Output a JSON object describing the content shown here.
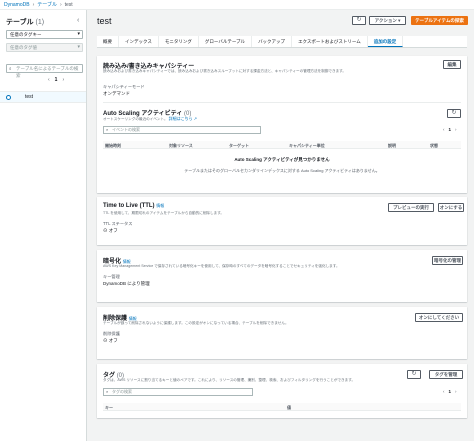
{
  "breadcrumb": {
    "root": "DynamoDB",
    "section": "テーブル",
    "current": "test"
  },
  "sidebar": {
    "title": "テーブル",
    "count": "(1)",
    "filter_select": "任意のタグキー",
    "value_select": "任意のタグ値",
    "search_placeholder": "テーブル名によるテーブルの検索",
    "page": "1",
    "tables": [
      {
        "name": "test"
      }
    ]
  },
  "header": {
    "title": "test",
    "actions_label": "アクション",
    "explore_label": "テーブルアイテムの探索"
  },
  "tabs": [
    {
      "label": "概要"
    },
    {
      "label": "インデックス"
    },
    {
      "label": "モニタリング"
    },
    {
      "label": "グローバルテーブル"
    },
    {
      "label": "バックアップ"
    },
    {
      "label": "エクスポートおよびストリーム"
    },
    {
      "label": "追加の設定"
    }
  ],
  "capacity": {
    "title": "読み込み/書き込みキャパシティー",
    "desc": "読み込みおよび書き込みキャパシティーでは、読み込みおよび書き込みスループットに対する課金方法と、キャパシティーの管理方法を制御できます。",
    "edit_label": "編集",
    "mode_label": "キャパシティーモード",
    "mode_value": "オンデマンド"
  },
  "autoscaling": {
    "title": "Auto Scaling アクティビティ",
    "count": "(0)",
    "desc": "オートスケーリングの最近のイベント。",
    "link": "詳細はこちら",
    "search_placeholder": "イベントの検索",
    "page": "1",
    "columns": [
      "開始時刻",
      "対象リソース",
      "ターゲット",
      "キャパシティー単位",
      "説明",
      "状態"
    ],
    "empty_title": "Auto Scaling アクティビティが見つかりません",
    "empty_desc": "テーブルまたはそのグローバルセカンダリインデックスに対する Auto Scaling アクティビティはありません。"
  },
  "ttl": {
    "title": "Time to Live (TTL)",
    "info": "情報",
    "desc": "TTL を使用して、期限切れのアイテムをテーブルから自動的に削除します。",
    "preview_label": "プレビューの実行",
    "enable_label": "オンにする",
    "status_label": "TTL ステータス",
    "status_value": "オフ"
  },
  "encryption": {
    "title": "暗号化",
    "info": "情報",
    "desc": "AWS Key Management Service で保存されている暗号化キーを使用して、保存時のすべてのデータを暗号化することでセキュリティを強化します。",
    "manage_label": "暗号化の管理",
    "key_label": "キー管理",
    "key_value": "DynamoDB により管理"
  },
  "deletion": {
    "title": "削除保護",
    "info": "情報",
    "desc": "テーブルが誤って削除されないように保護します。この設定がオンになっている場合、テーブルを削除できません。",
    "toggle_label": "オンにしてください",
    "status_label": "削除保護",
    "status_value": "オフ"
  },
  "tags": {
    "title": "タグ",
    "count": "(0)",
    "desc": "タグは、AWS リソースに割り当てるキーと値のペアです。これにより、リソースの管理、識別、整理、検索、およびフィルタリングを行うことができます。",
    "manage_label": "タグを管理",
    "search_placeholder": "タグの検索",
    "page": "1",
    "columns": [
      "キー",
      "値"
    ]
  },
  "colors": {
    "accent": "#0073bb",
    "primary": "#ec7211",
    "ok": "#1d8102"
  }
}
